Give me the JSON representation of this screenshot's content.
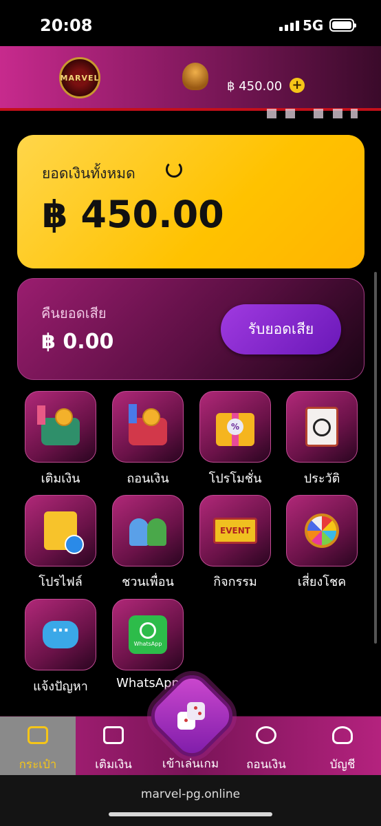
{
  "status_bar": {
    "time": "20:08",
    "network": "5G"
  },
  "header": {
    "logo_text": "MARVEL",
    "balance": "฿ 450.00",
    "add_symbol": "+"
  },
  "balance_card": {
    "label": "ยอดเงินทั้งหมด",
    "amount": "฿ 450.00"
  },
  "cashback_card": {
    "label": "คืนยอดเสีย",
    "amount": "฿ 0.00",
    "button_label": "รับยอดเสีย"
  },
  "menu": {
    "items": [
      {
        "label": "เติมเงิน",
        "icon": "deposit-wallet-icon"
      },
      {
        "label": "ถอนเงิน",
        "icon": "withdraw-wallet-icon"
      },
      {
        "label": "โปรโมชั่น",
        "icon": "gift-icon"
      },
      {
        "label": "ประวัติ",
        "icon": "history-clipboard-icon"
      },
      {
        "label": "โปรไฟล์",
        "icon": "profile-icon"
      },
      {
        "label": "ชวนเพื่อน",
        "icon": "friends-icon"
      },
      {
        "label": "กิจกรรม",
        "icon": "event-sign-icon"
      },
      {
        "label": "เสี่ยงโชค",
        "icon": "lucky-wheel-icon"
      },
      {
        "label": "แจ้งปัญหา",
        "icon": "chat-bubble-icon"
      },
      {
        "label": "WhatsApp",
        "icon": "whatsapp-icon"
      }
    ],
    "event_sign_text": "EVENT",
    "whatsapp_icon_text": "WhatsApp",
    "promo_percent": "%"
  },
  "bottom_nav": {
    "items": [
      {
        "label": "กระเป๋า",
        "icon": "wallet-icon"
      },
      {
        "label": "เติมเงิน",
        "icon": "deposit-icon"
      },
      {
        "label": "เข้าเล่นเกม",
        "icon": "dice-icon"
      },
      {
        "label": "ถอนเงิน",
        "icon": "money-hand-icon"
      },
      {
        "label": "บัญชี",
        "icon": "user-icon"
      }
    ],
    "active_index": 0
  },
  "browser": {
    "url": "marvel-pg.online"
  },
  "colors": {
    "accent_gold": "#f5c518",
    "brand_magenta": "#b4227e",
    "button_purple": "#8a2ad0"
  }
}
